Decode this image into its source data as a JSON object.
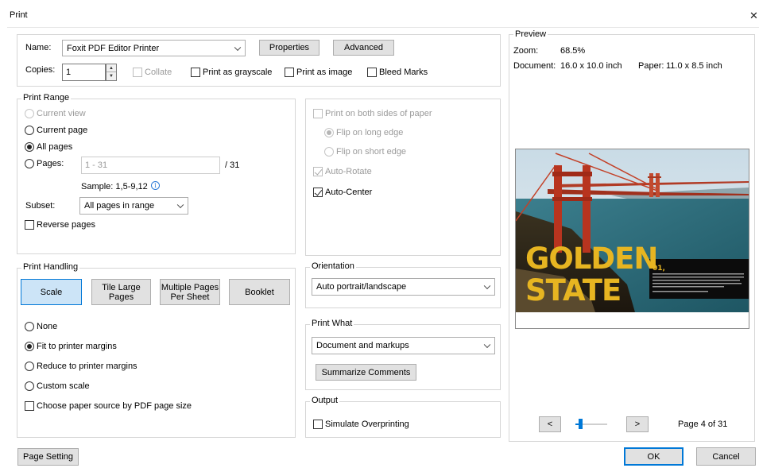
{
  "window": {
    "title": "Print",
    "close_glyph": "✕"
  },
  "printer": {
    "name_label": "Name:",
    "name_value": "Foxit PDF Editor Printer",
    "properties_label": "Properties",
    "advanced_label": "Advanced",
    "copies_label": "Copies:",
    "copies_value": "1",
    "collate_label": "Collate",
    "grayscale_label": "Print as grayscale",
    "as_image_label": "Print as image",
    "bleed_label": "Bleed Marks"
  },
  "print_range": {
    "title": "Print Range",
    "current_view": "Current view",
    "current_page": "Current page",
    "all_pages": "All pages",
    "pages_label": "Pages:",
    "pages_placeholder": "1 - 31",
    "pages_total": "/ 31",
    "sample": "Sample: 1,5-9,12",
    "subset_label": "Subset:",
    "subset_value": "All pages in range",
    "reverse_label": "Reverse pages"
  },
  "duplex": {
    "both_sides": "Print on both sides of paper",
    "flip_long": "Flip on long edge",
    "flip_short": "Flip on short edge",
    "auto_rotate": "Auto-Rotate",
    "auto_center": "Auto-Center"
  },
  "handling": {
    "title": "Print Handling",
    "scale": "Scale",
    "tile_large": "Tile Large Pages",
    "multiple": "Multiple Pages Per Sheet",
    "booklet": "Booklet",
    "none": "None",
    "fit": "Fit to printer margins",
    "reduce": "Reduce to printer margins",
    "custom": "Custom scale",
    "paper_source": "Choose paper source by PDF page size"
  },
  "orientation": {
    "title": "Orientation",
    "value": "Auto portrait/landscape"
  },
  "print_what": {
    "title": "Print What",
    "value": "Document and markups",
    "summarize": "Summarize Comments"
  },
  "output": {
    "title": "Output",
    "simulate": "Simulate Overprinting"
  },
  "preview": {
    "title": "Preview",
    "zoom_label": "Zoom:",
    "zoom_value": "68.5%",
    "document_label": "Document:",
    "document_value": "16.0 x 10.0 inch",
    "paper_label": "Paper:",
    "paper_value": "11.0 x 8.5 inch",
    "image_title_line1": "GOLDEN",
    "image_title_line2": "STATE",
    "image_badge": "01,",
    "prev_glyph": "<",
    "next_glyph": ">",
    "page_status": "Page 4 of 31",
    "slider_fraction": 0.1
  },
  "footer": {
    "page_setting": "Page Setting",
    "ok": "OK",
    "cancel": "Cancel"
  },
  "colors": {
    "accent": "#0078d7",
    "selected_button_bg": "#cce4f7",
    "title_gold": "#e7b521"
  }
}
